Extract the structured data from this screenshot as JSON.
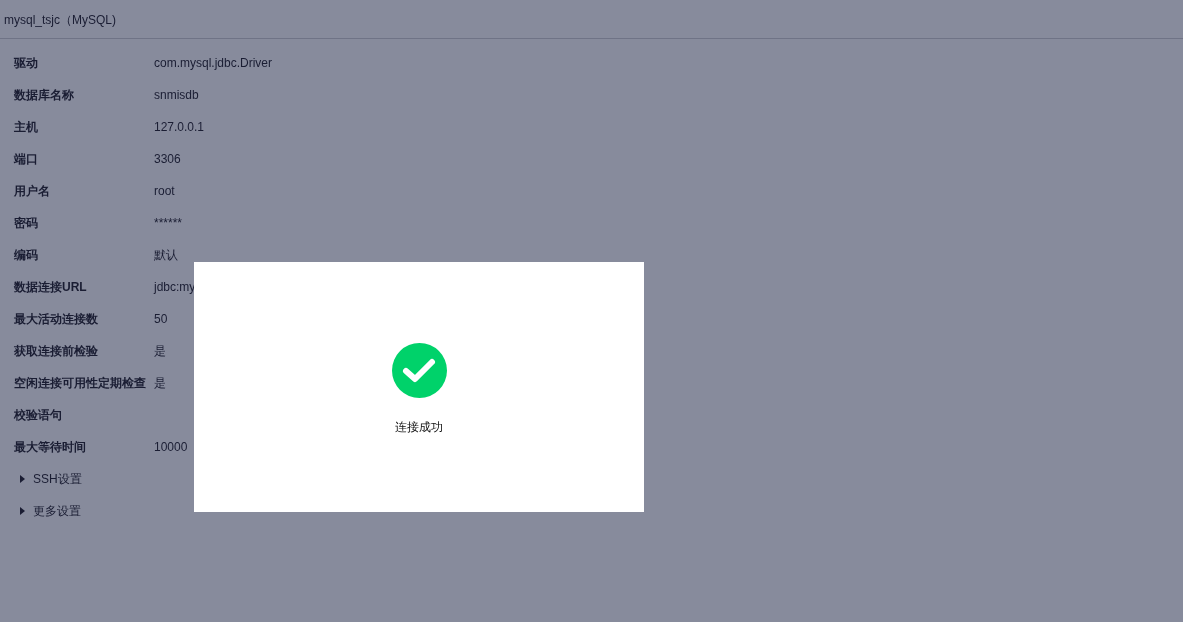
{
  "title": "mysql_tsjc（MySQL)",
  "fields": [
    {
      "label": "驱动",
      "value": "com.mysql.jdbc.Driver"
    },
    {
      "label": "数据库名称",
      "value": "snmisdb"
    },
    {
      "label": "主机",
      "value": "127.0.0.1"
    },
    {
      "label": "端口",
      "value": "3306"
    },
    {
      "label": "用户名",
      "value": "root"
    },
    {
      "label": "密码",
      "value": "******"
    },
    {
      "label": "编码",
      "value": "默认"
    },
    {
      "label": "数据连接URL",
      "value": "jdbc:my"
    },
    {
      "label": "最大活动连接数",
      "value": "50"
    },
    {
      "label": "获取连接前检验",
      "value": "是"
    },
    {
      "label": "空闲连接可用性定期检查",
      "value": "是"
    },
    {
      "label": "校验语句"
    },
    {
      "label": "最大等待时间",
      "value": "10000"
    }
  ],
  "sections": [
    {
      "label": "SSH设置",
      "expanded": false
    },
    {
      "label": "更多设置",
      "expanded": false
    }
  ],
  "dialog": {
    "message": "连接成功"
  }
}
